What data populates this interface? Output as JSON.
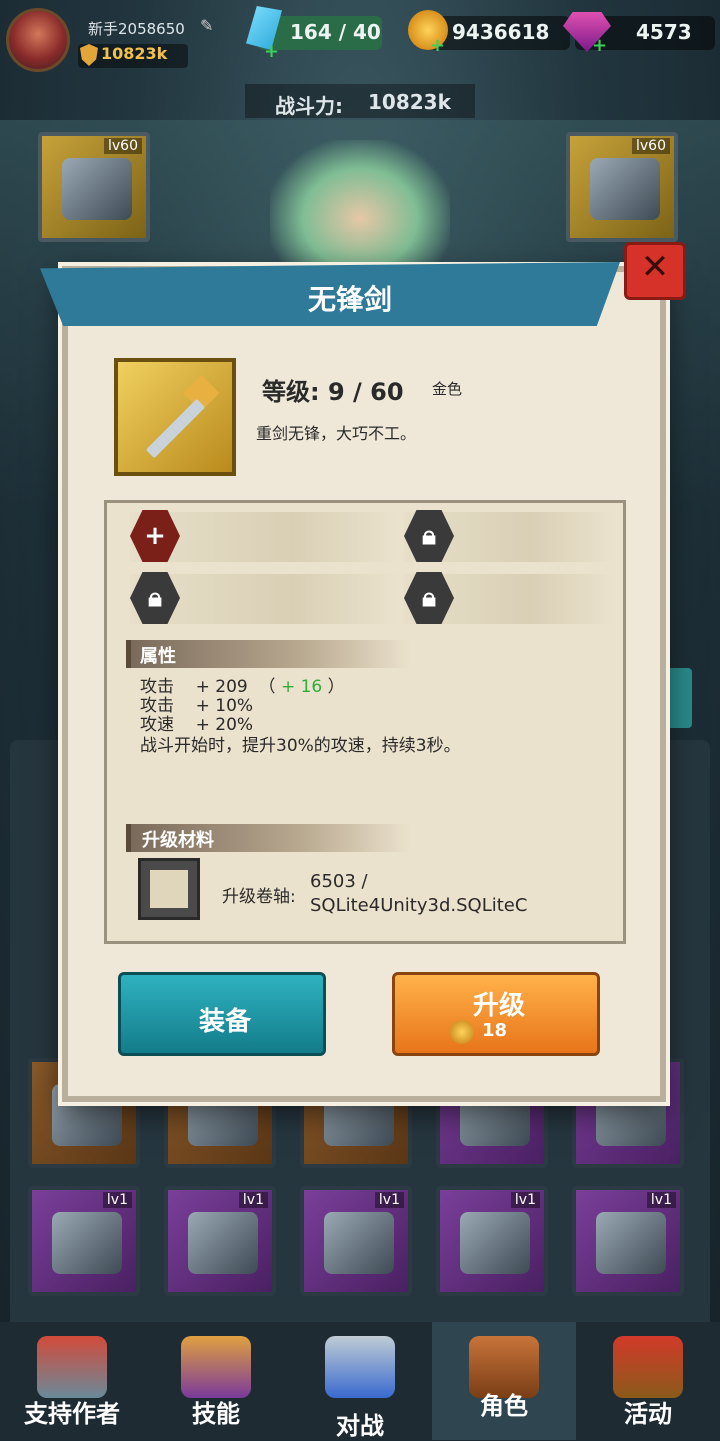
{
  "header": {
    "player_name": "新手2058650",
    "power": "10823k",
    "energy": "164 / 40",
    "gold": "9436618",
    "gems": "4573"
  },
  "combat": {
    "label": "战斗力:",
    "value": "10823k"
  },
  "slots": {
    "left_top_lv": "lv60",
    "right_top_lv": "lv60",
    "lv1": "lv1"
  },
  "modal": {
    "title": "无锋剑",
    "level_label": "等级: 9 / 60",
    "quality": "金色",
    "description": "重剑无锋，大巧不工。",
    "attributes_header": "属性",
    "attributes": [
      {
        "name": "攻击",
        "value": "+ 209",
        "open": "（",
        "bonus": "+ 16",
        "close": "）"
      },
      {
        "name": "攻击",
        "value": "+ 10%"
      },
      {
        "name": "攻速",
        "value": "+ 20%"
      }
    ],
    "skill_text": "战斗开始时，提升30%的攻速，持续3秒。",
    "materials_header": "升级材料",
    "material_label": "升级卷轴:",
    "material_value_line1": "6503 /",
    "material_value_line2": "SQLite4Unity3d.SQLiteC",
    "equip_button": "装备",
    "upgrade_button": "升级",
    "upgrade_cost": "18"
  },
  "nav": [
    {
      "label": "支持作者",
      "icon": "shop-icon"
    },
    {
      "label": "技能",
      "icon": "skill-icon"
    },
    {
      "label": "对战",
      "icon": "battle-icon"
    },
    {
      "label": "角色",
      "icon": "backpack-icon"
    },
    {
      "label": "活动",
      "icon": "event-icon"
    }
  ],
  "colors": {
    "banner": "#2f7a98",
    "equip": "#1a98a6",
    "upgrade": "#f08a26",
    "close": "#d6322a"
  }
}
